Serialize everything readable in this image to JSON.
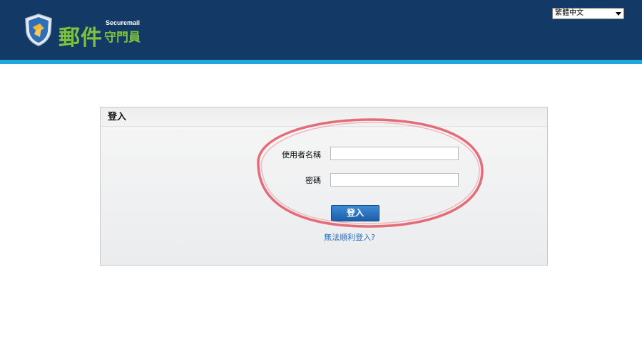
{
  "header": {
    "logo_big": "郵件",
    "logo_sub": "Securemail",
    "logo_small": "守門員",
    "language_selected": "繁體中文"
  },
  "login": {
    "title": "登入",
    "username_label": "使用者名稱",
    "username_value": "",
    "password_label": "密碼",
    "password_value": "",
    "submit_label": "登入",
    "help_link": "無法順利登入?"
  },
  "colors": {
    "header_bg": "#133a66",
    "header_stripe": "#1fa8dc",
    "logo_green": "#7cc142",
    "button_blue": "#1c5fa8",
    "link_blue": "#2a6bbf",
    "annotation_red": "#e05563"
  },
  "icons": {
    "logo": "shield-icon",
    "language_dropdown": "chevron-down-icon"
  }
}
